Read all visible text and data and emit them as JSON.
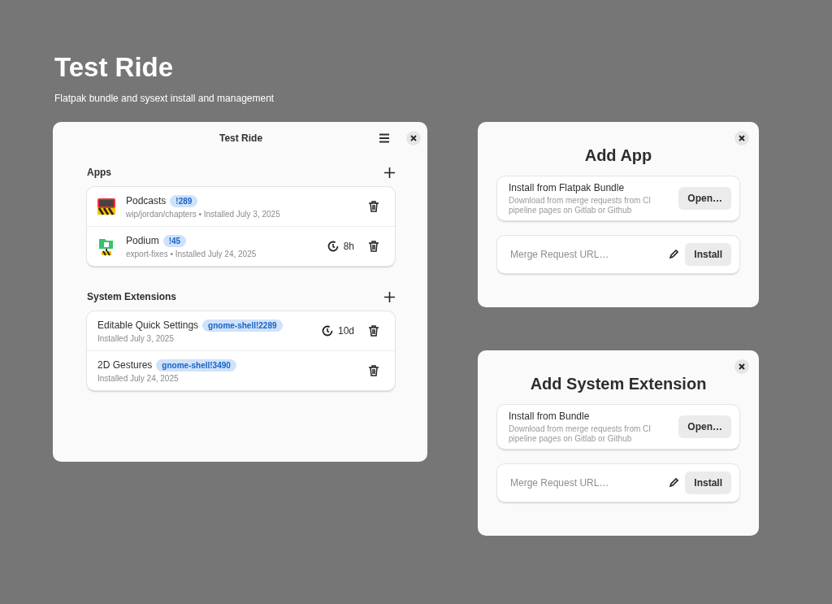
{
  "header": {
    "title": "Test Ride",
    "subtitle": "Flatpak bundle and sysext install and management"
  },
  "main_window": {
    "title": "Test Ride",
    "sections": [
      {
        "title": "Apps",
        "kind": "apps",
        "rows": [
          {
            "name": "Podcasts",
            "badge": "!289",
            "detail": "wip/jordan/chapters • Installed July 3, 2025"
          },
          {
            "name": "Podium",
            "badge": "!45",
            "detail": "export-fixes • Installed July 24, 2025",
            "timer": "8h"
          }
        ]
      },
      {
        "title": "System Extensions",
        "kind": "extensions",
        "rows": [
          {
            "name": "Editable Quick Settings",
            "badge": "gnome-shell!2289",
            "detail": "Installed July 3, 2025",
            "timer": "10d"
          },
          {
            "name": "2D Gestures",
            "badge": "gnome-shell!3490",
            "detail": "Installed July 24, 2025"
          }
        ]
      }
    ]
  },
  "dialogs": [
    {
      "title": "Add App",
      "bundle_title": "Install from Flatpak Bundle",
      "bundle_desc": "Download from merge requests from CI pipeline pages on Gitlab or Github",
      "open_button": "Open…",
      "url_placeholder": "Merge Request URL…",
      "install_button": "Install"
    },
    {
      "title": "Add System Extension",
      "bundle_title": "Install from Bundle",
      "bundle_desc": "Download from merge requests from CI pipeline pages on Gitlab or Github",
      "open_button": "Open…",
      "url_placeholder": "Merge Request URL…",
      "install_button": "Install"
    }
  ]
}
